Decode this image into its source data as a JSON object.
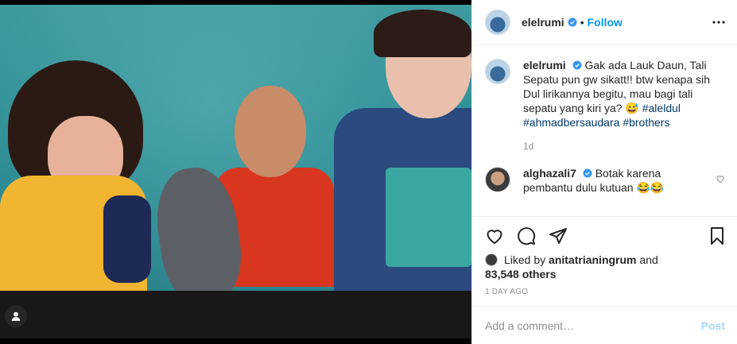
{
  "post": {
    "author": "elelrumi",
    "follow_label": "Follow",
    "separator": "•",
    "caption_text": "Gak ada Lauk Daun, Tali Sepatu pun gw sikatt!! btw kenapa sih Dul lirikannya begitu, mau bagi tali sepatu yang kiri ya? 😅 ",
    "hashtags": [
      "#aleldul",
      "#ahmadbersaudara",
      "#brothers"
    ],
    "caption_time": "1d"
  },
  "comments": [
    {
      "username": "alghazali7",
      "text": "Botak karena pembantu dulu kutuan 😂😂"
    }
  ],
  "likes": {
    "prefix": "Liked by",
    "liker": "anitatrianingrum",
    "and": "and",
    "count": "83,548 others"
  },
  "timestamp": "1 DAY AGO",
  "add_comment": {
    "placeholder": "Add a comment…",
    "post_label": "Post"
  },
  "colors": {
    "accent": "#0095f6",
    "hashtag": "#00376b",
    "muted": "#8e8e8e",
    "verified": "#3897f0"
  },
  "icons": [
    "more-icon",
    "heart-icon",
    "comment-icon",
    "share-icon",
    "bookmark-icon",
    "verified-badge-icon",
    "user-tag-icon"
  ]
}
